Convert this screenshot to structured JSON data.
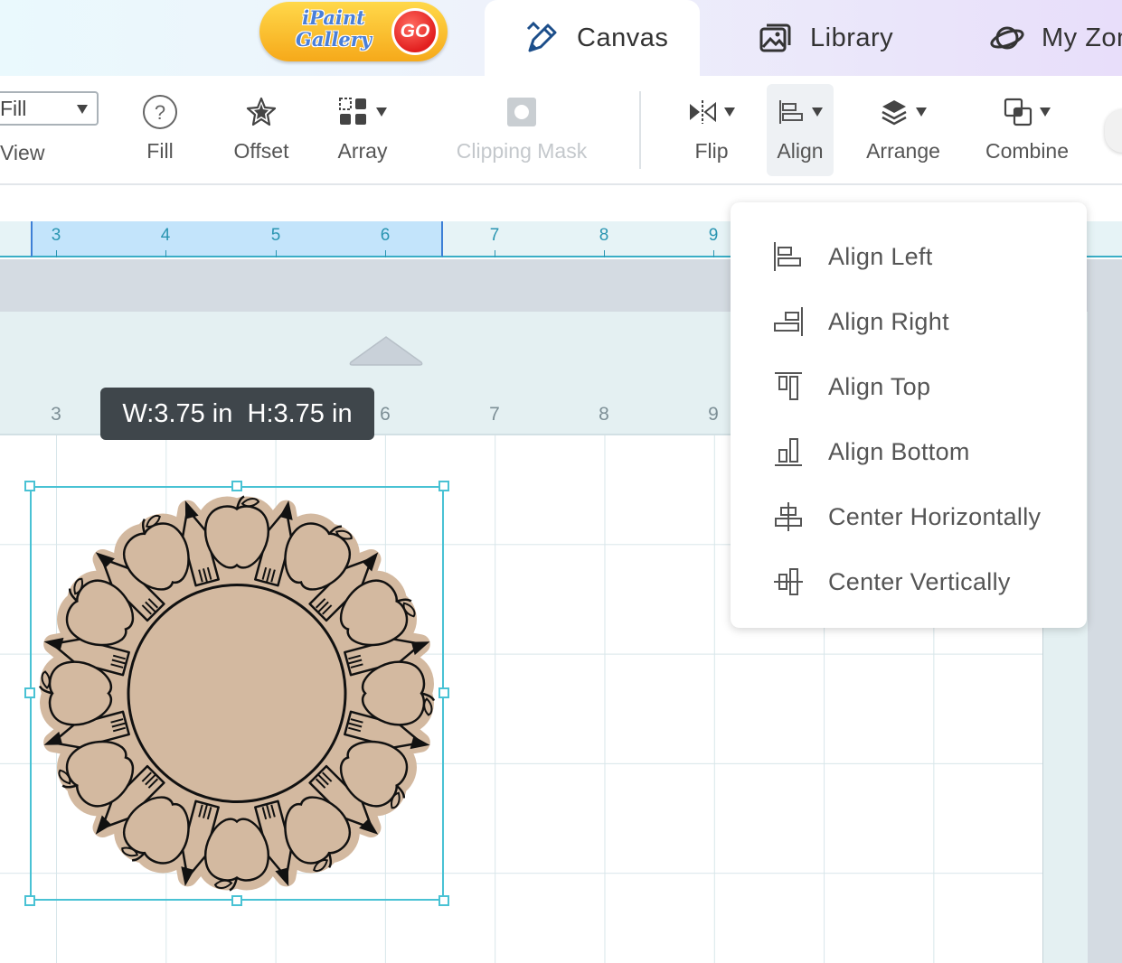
{
  "header": {
    "gallery_button": {
      "text": "iPaint\nGallery",
      "badge": "GO"
    },
    "tabs": [
      {
        "label": "Canvas",
        "icon": "pencil-ruler-icon",
        "active": true
      },
      {
        "label": "Library",
        "icon": "image-gallery-icon",
        "active": false
      },
      {
        "label": "My Zon",
        "icon": "planet-icon",
        "active": false
      }
    ]
  },
  "toolbar": {
    "fill_select_value": "Fill",
    "view_label": "View",
    "tools": {
      "fill": "Fill",
      "offset": "Offset",
      "array": "Array",
      "clipping_mask": "Clipping Mask",
      "flip": "Flip",
      "align": "Align",
      "arrange": "Arrange",
      "combine": "Combine"
    }
  },
  "ruler": {
    "top_numbers": [
      "3",
      "4",
      "5",
      "6",
      "7",
      "8",
      "9"
    ],
    "mat_numbers": [
      "3",
      "6",
      "7",
      "8",
      "9"
    ]
  },
  "size_tooltip": "W:3.75 in  H:3.75 in",
  "align_menu": {
    "items": [
      {
        "label": "Align Left",
        "icon": "align-left-icon"
      },
      {
        "label": "Align Right",
        "icon": "align-right-icon"
      },
      {
        "label": "Align Top",
        "icon": "align-top-icon"
      },
      {
        "label": "Align Bottom",
        "icon": "align-bottom-icon"
      },
      {
        "label": "Center Horizontally",
        "icon": "center-horizontally-icon"
      },
      {
        "label": "Center Vertically",
        "icon": "center-vertically-icon"
      }
    ]
  },
  "colors": {
    "accent": "#49c2d4",
    "artwork_fill": "#d3b9a0",
    "ruler_selection": "#c3e4fb"
  }
}
